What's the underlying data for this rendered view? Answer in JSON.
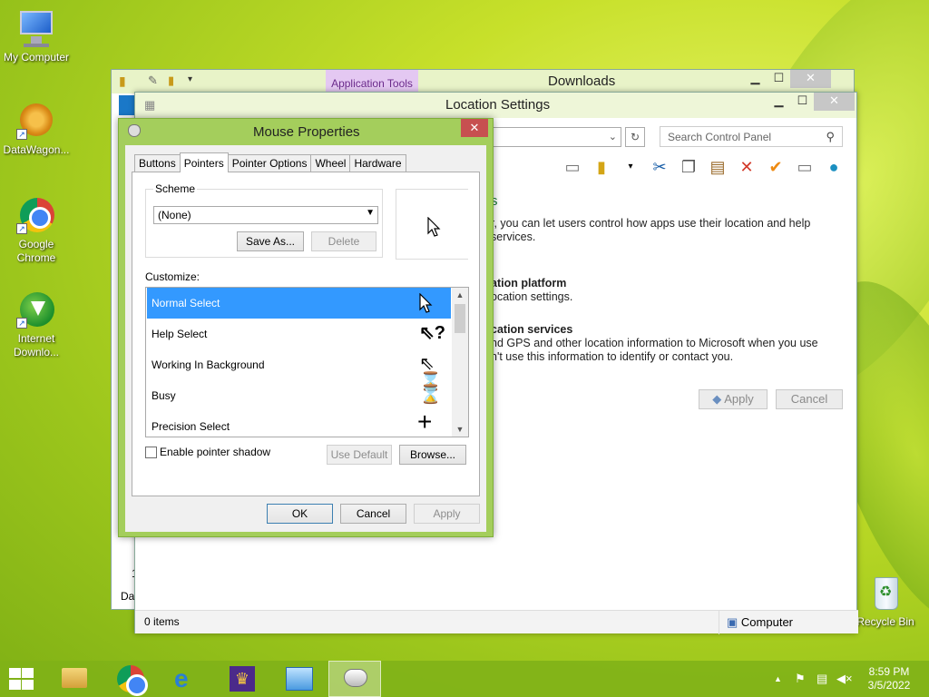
{
  "desktop": {
    "icons": [
      {
        "label": "My Computer"
      },
      {
        "label": "DataWagon..."
      },
      {
        "label": "Google Chrome"
      },
      {
        "label": "Internet Downlo..."
      },
      {
        "label": "Recycle Bin"
      }
    ]
  },
  "downloads_window": {
    "title": "Downloads",
    "ribbon_tab": "Application Tools",
    "status_left": "Dat",
    "left_digit": "1"
  },
  "location_window": {
    "title": "Location Settings",
    "search_placeholder": "Search Control Panel",
    "heading_fragment": "s",
    "para1_line1": "r, you can let users control how apps use their location and help",
    "para1_line2": "services.",
    "sect2_title": "ation platform",
    "sect2_text": "ocation settings.",
    "sect3_title": "cation services",
    "sect3_line1": "nd GPS and other location information to Microsoft when you use",
    "sect3_line2": "n't use this information to identify or contact you.",
    "apply_label": "Apply",
    "cancel_label": "Cancel",
    "status_items": "0 items",
    "status_computer": "Computer"
  },
  "mouse_properties": {
    "title": "Mouse Properties",
    "tabs": [
      "Buttons",
      "Pointers",
      "Pointer Options",
      "Wheel",
      "Hardware"
    ],
    "active_tab": "Pointers",
    "scheme_label": "Scheme",
    "scheme_value": "(None)",
    "save_as": "Save As...",
    "delete": "Delete",
    "customize_label": "Customize:",
    "cursors": [
      {
        "label": "Normal Select",
        "glyph": "arrow-cursor-icon"
      },
      {
        "label": "Help Select",
        "glyph": "help-cursor-icon"
      },
      {
        "label": "Working In Background",
        "glyph": "working-cursor-icon"
      },
      {
        "label": "Busy",
        "glyph": "hourglass-cursor-icon"
      },
      {
        "label": "Precision Select",
        "glyph": "crosshair-cursor-icon"
      }
    ],
    "selected_cursor": "Normal Select",
    "enable_shadow": "Enable pointer shadow",
    "shadow_checked": false,
    "use_default": "Use Default",
    "browse": "Browse...",
    "ok": "OK",
    "cancel": "Cancel",
    "apply": "Apply"
  },
  "taskbar": {
    "time": "8:59 PM",
    "date": "3/5/2022"
  }
}
